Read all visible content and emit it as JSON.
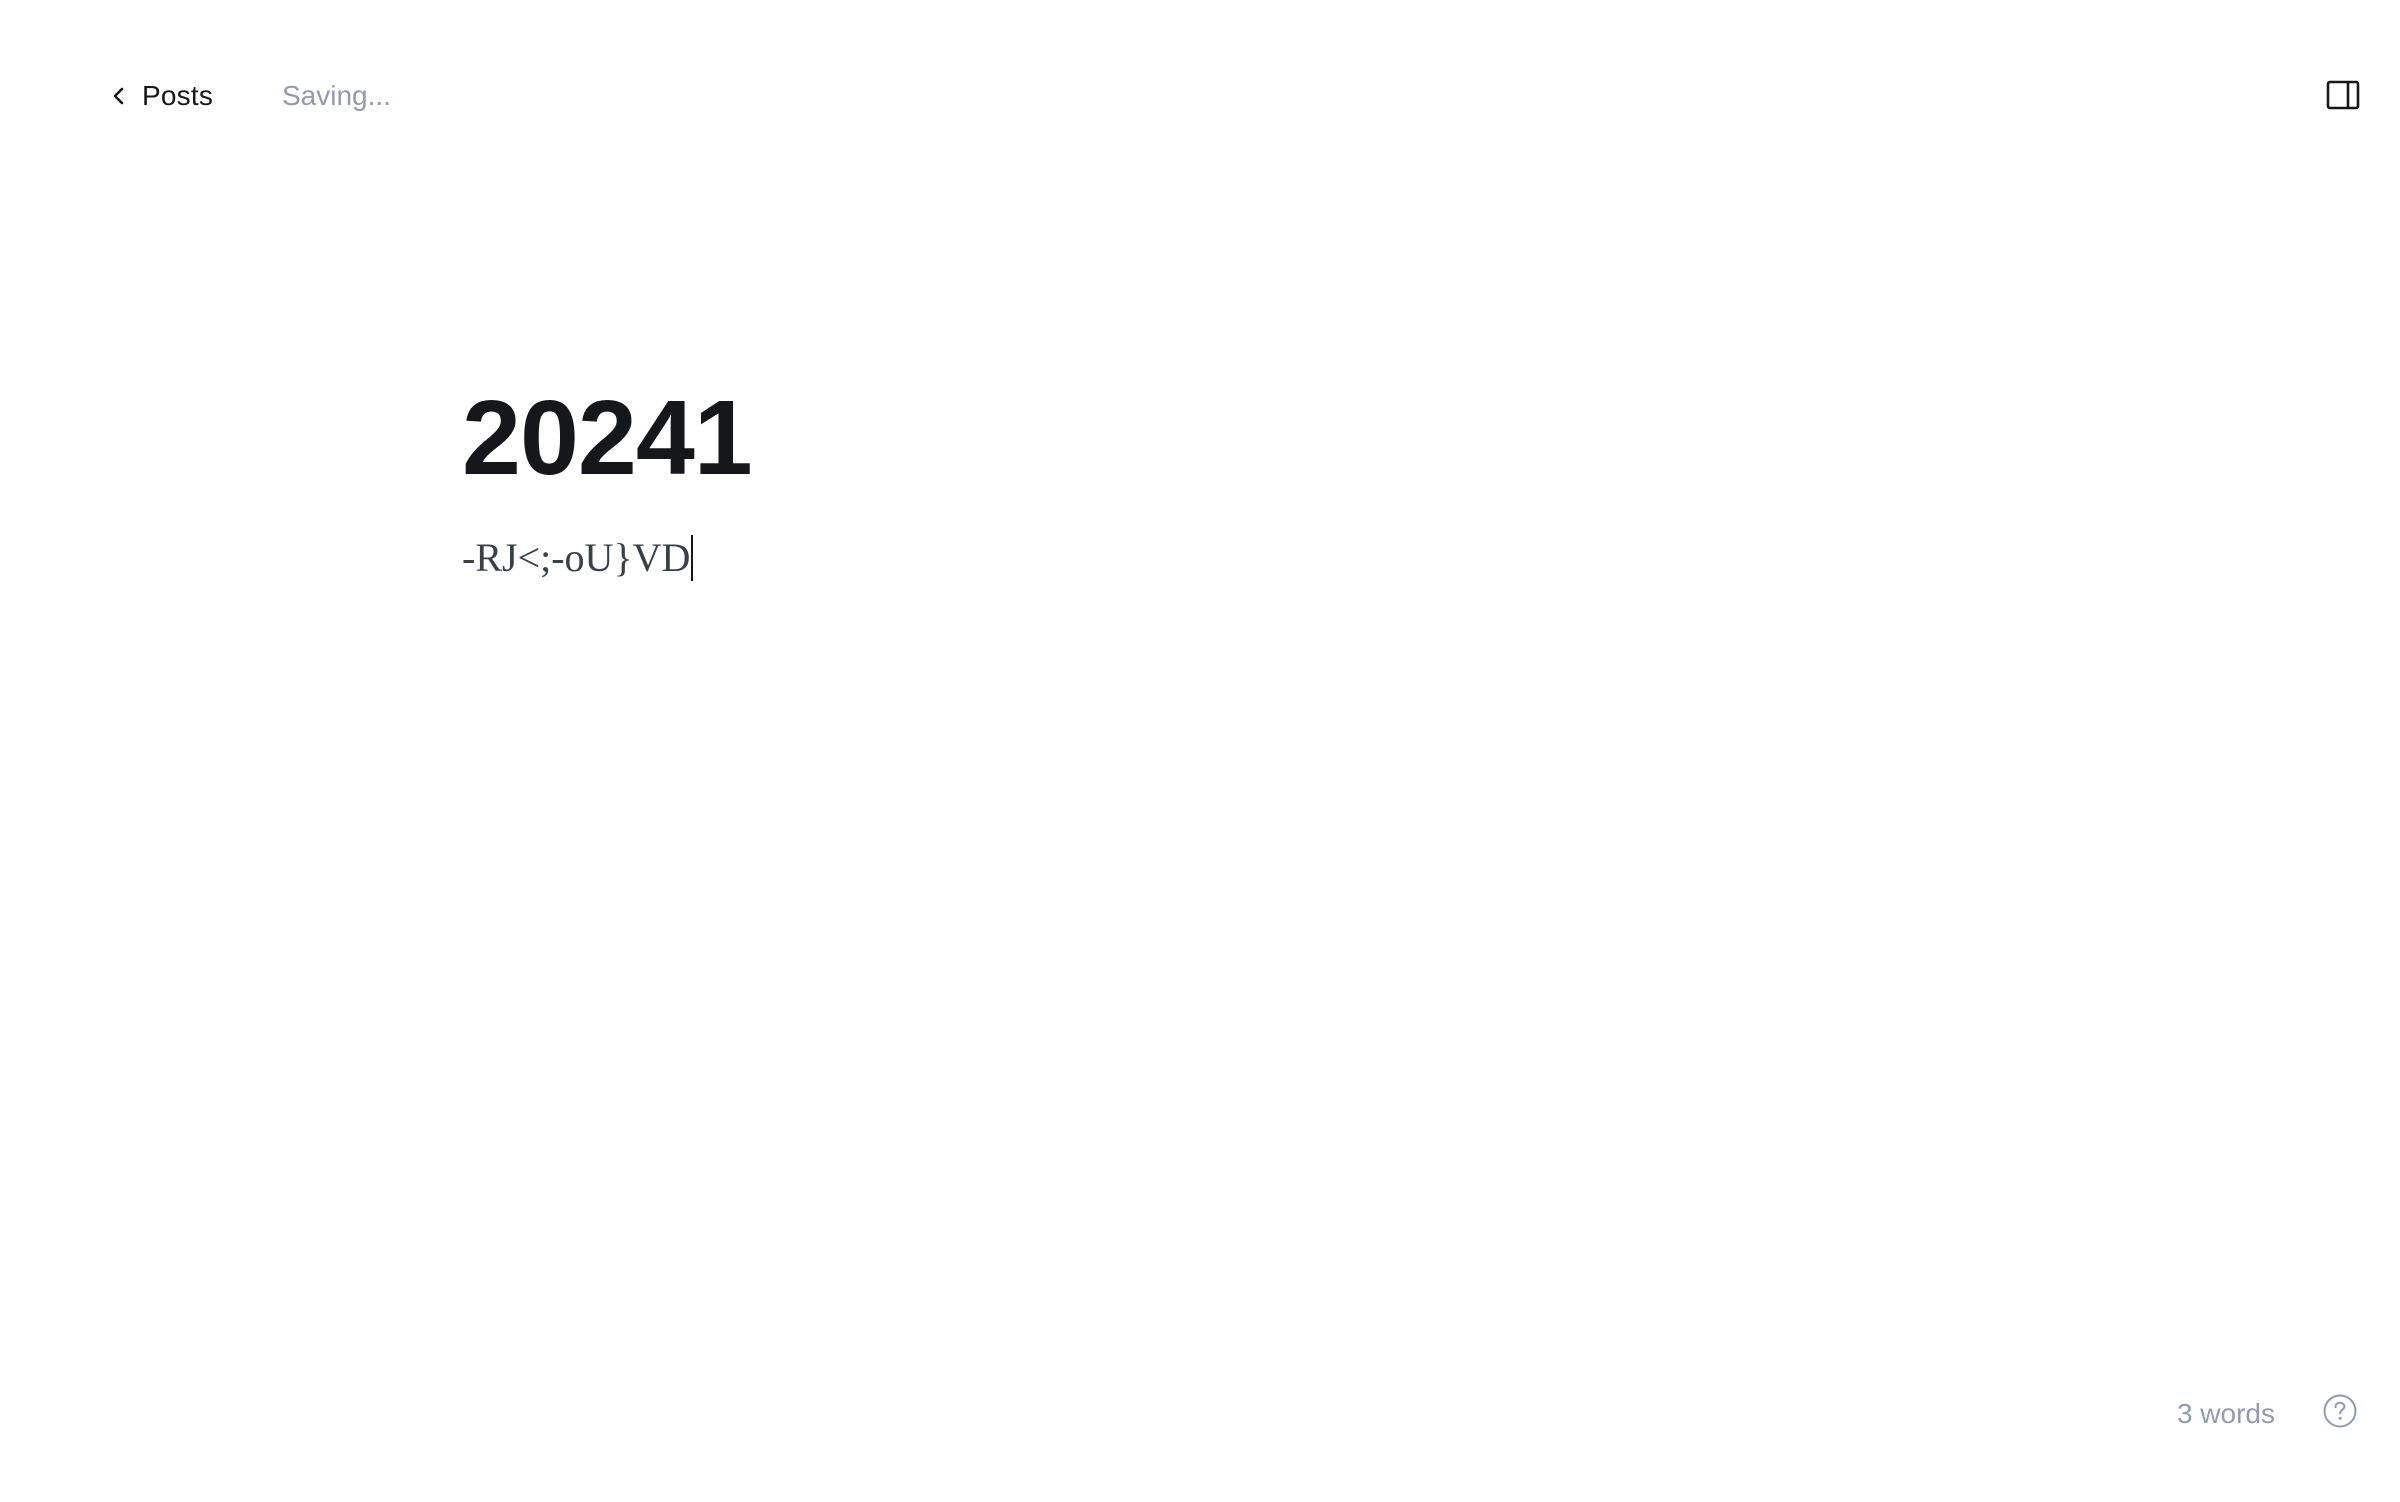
{
  "header": {
    "back_label": "Posts",
    "save_status": "Saving..."
  },
  "post": {
    "title": "20241",
    "body": "-RJ<;-oU}VD"
  },
  "footer": {
    "word_count": "3 words"
  },
  "icons": {
    "back": "chevron-left-icon",
    "sidebar": "sidebar-panel-icon",
    "help": "question-circle-icon"
  },
  "colors": {
    "text": "#15171a",
    "muted": "#8e9cac",
    "body_text": "#394047"
  }
}
